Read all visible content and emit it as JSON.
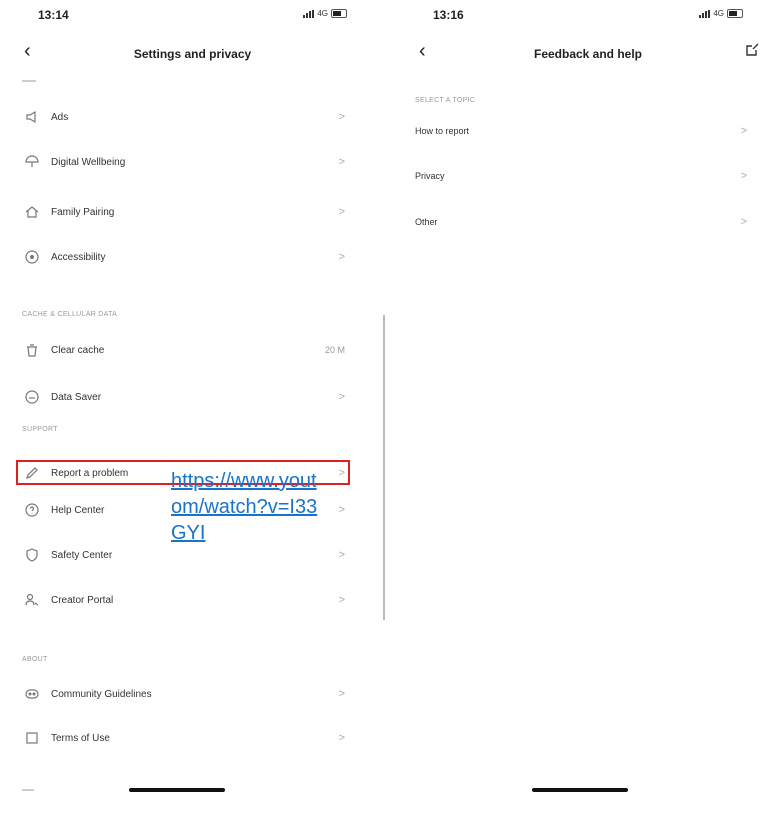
{
  "left": {
    "status": {
      "time": "13:14",
      "network": "4G"
    },
    "title": "Settings and privacy",
    "items": [
      {
        "label": "Ads",
        "icon": "megaphone-icon"
      },
      {
        "label": "Digital Wellbeing",
        "icon": "umbrella-icon"
      },
      {
        "label": "Family Pairing",
        "icon": "home-icon"
      },
      {
        "label": "Accessibility",
        "icon": "accessibility-icon"
      }
    ],
    "sections": {
      "cache": "CACHE & CELLULAR DATA",
      "support": "SUPPORT",
      "about": "ABOUT"
    },
    "cache_items": [
      {
        "label": "Clear cache",
        "value": "20 M",
        "icon": "trash-icon"
      },
      {
        "label": "Data Saver",
        "icon": "data-saver-icon"
      }
    ],
    "support_items": [
      {
        "label": "Report a problem",
        "icon": "pencil-icon",
        "highlighted": true
      },
      {
        "label": "Help Center",
        "icon": "question-icon"
      },
      {
        "label": "Safety Center",
        "icon": "shield-icon"
      },
      {
        "label": "Creator Portal",
        "icon": "creator-icon"
      }
    ],
    "about_items": [
      {
        "label": "Community Guidelines",
        "icon": "guidelines-icon"
      },
      {
        "label": "Terms of Use",
        "icon": "document-icon"
      }
    ],
    "chevron": ">"
  },
  "right": {
    "status": {
      "time": "13:16",
      "network": "4G"
    },
    "title": "Feedback and help",
    "section": "SELECT A TOPIC",
    "topics": [
      "How to report",
      "Privacy",
      "Other"
    ],
    "link": "https://www.yout\nom/watch?v=I33\nGYI"
  },
  "colors": {
    "highlight": "#e02020",
    "link": "#1a73c8"
  }
}
